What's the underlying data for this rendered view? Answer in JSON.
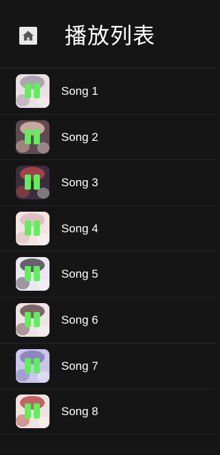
{
  "header": {
    "title": "播放列表",
    "home_icon": "home-icon"
  },
  "songs": [
    {
      "name": "Song 1",
      "thumb_bg": "#eadfe3",
      "thumb_accent": "#9a8f9c",
      "indicator": "equalizer-icon"
    },
    {
      "name": "Song 2",
      "thumb_bg": "#5f4a52",
      "thumb_accent": "#e8c8b8",
      "indicator": "equalizer-icon"
    },
    {
      "name": "Song 3",
      "thumb_bg": "#3a2e3d",
      "thumb_accent": "#c84a4e",
      "indicator": "equalizer-icon"
    },
    {
      "name": "Song 4",
      "thumb_bg": "#f3e4e2",
      "thumb_accent": "#d8b4b8",
      "indicator": "equalizer-icon"
    },
    {
      "name": "Song 5",
      "thumb_bg": "#ebe7ef",
      "thumb_accent": "#3b3444",
      "indicator": "equalizer-icon"
    },
    {
      "name": "Song 6",
      "thumb_bg": "#ede2e6",
      "thumb_accent": "#5c3a3c",
      "indicator": "equalizer-icon"
    },
    {
      "name": "Song 7",
      "thumb_bg": "#c9c6ea",
      "thumb_accent": "#7b6fb4",
      "indicator": "equalizer-icon"
    },
    {
      "name": "Song 8",
      "thumb_bg": "#efe3df",
      "thumb_accent": "#b23a3a",
      "indicator": "equalizer-icon"
    }
  ],
  "colors": {
    "background": "#151515",
    "divider": "#262626",
    "indicator": "#5ef05a",
    "text": "#ffffff"
  }
}
